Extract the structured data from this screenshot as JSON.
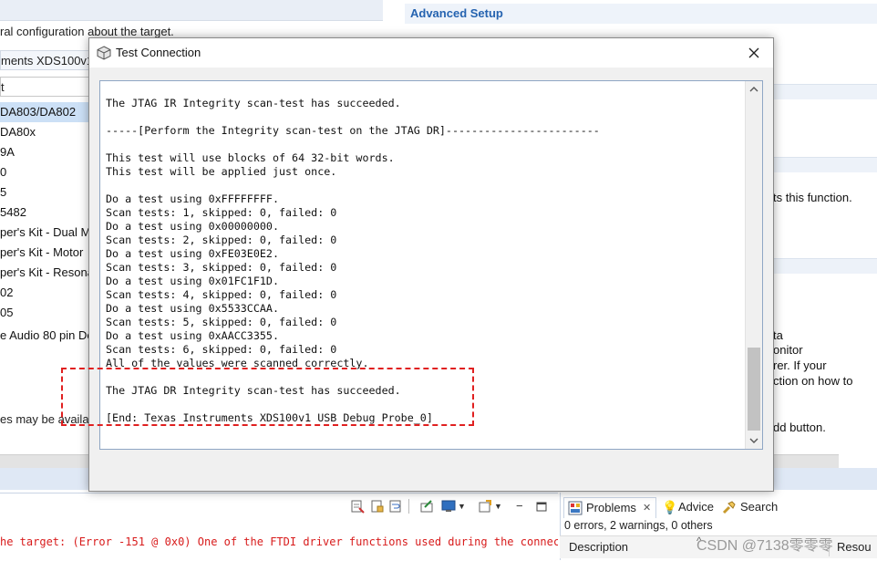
{
  "background": {
    "left_header_text": "ral configuration about the target.",
    "connection_text": "ments XDS100v1",
    "board_label": "t",
    "device_items": [
      "DA803/DA802",
      "DA80x",
      "9A",
      "0",
      "5",
      "5482",
      "per's Kit - Dual M",
      "per's Kit - Motor",
      "per's Kit - Resona",
      "02",
      "05",
      "e Audio 80 pin De"
    ],
    "left_footer_text": "es may be availa",
    "right_title": "Advanced Setup",
    "right_texts": [
      "ts this function.",
      "ta",
      "onitor",
      "rer. If your",
      "ction on how to",
      "dd button."
    ]
  },
  "dialog": {
    "title": "Test Connection",
    "log_text": "The JTAG IR Integrity scan-test has succeeded.\n\n-----[Perform the Integrity scan-test on the JTAG DR]------------------------\n\nThis test will use blocks of 64 32-bit words.\nThis test will be applied just once.\n\nDo a test using 0xFFFFFFFF.\nScan tests: 1, skipped: 0, failed: 0\nDo a test using 0x00000000.\nScan tests: 2, skipped: 0, failed: 0\nDo a test using 0xFE03E0E2.\nScan tests: 3, skipped: 0, failed: 0\nDo a test using 0x01FC1F1D.\nScan tests: 4, skipped: 0, failed: 0\nDo a test using 0x5533CCAA.\nScan tests: 5, skipped: 0, failed: 0\nDo a test using 0xAACC3355.\nScan tests: 6, skipped: 0, failed: 0\nAll of the values were scanned correctly.\n\nThe JTAG DR Integrity scan-test has succeeded.\n\n[End: Texas Instruments XDS100v1 USB Debug Probe_0]",
    "highlight_color": "#e02020"
  },
  "console": {
    "error_line": "he target: (Error -151 @ 0x0) One of the FTDI driver functions used during the connec"
  },
  "problems": {
    "tabs": [
      {
        "label": "Problems",
        "icon": "problems-icon"
      },
      {
        "label": "Advice",
        "icon": "lightbulb-icon"
      },
      {
        "label": "Search",
        "icon": "flashlight-icon"
      }
    ],
    "status": "0 errors, 2 warnings, 0 others",
    "column_description": "Description",
    "column_resource": "Resou"
  },
  "watermark": "CSDN @7138零零零"
}
